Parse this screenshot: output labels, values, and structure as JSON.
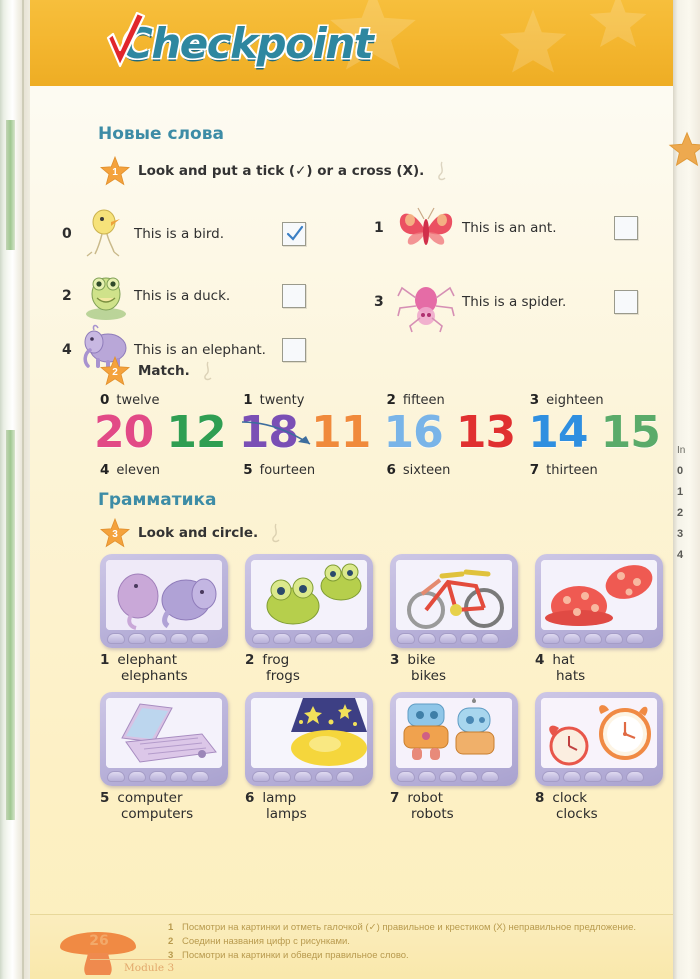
{
  "header": {
    "logo_text": "Checkpoint",
    "logo_check_icon": "red-check-icon"
  },
  "sections": {
    "vocabulary_title": "Новые слова",
    "grammar_title": "Грамматика"
  },
  "exercise1": {
    "number": "1",
    "instruction": "Look and put a tick (✓) or a cross (X).",
    "items": [
      {
        "num": "0",
        "text": "This is a bird.",
        "picture": "duckling-bird-icon",
        "checked": true,
        "mark": "✓"
      },
      {
        "num": "1",
        "text": "This is an ant.",
        "picture": "butterfly-icon",
        "checked": false,
        "mark": ""
      },
      {
        "num": "2",
        "text": "This is a duck.",
        "picture": "frog-icon",
        "checked": false,
        "mark": ""
      },
      {
        "num": "3",
        "text": "This is a spider.",
        "picture": "spider-icon",
        "checked": false,
        "mark": ""
      },
      {
        "num": "4",
        "text": "This is an elephant.",
        "picture": "elephant-icon",
        "checked": false,
        "mark": ""
      }
    ]
  },
  "exercise2": {
    "number": "2",
    "instruction": "Match.",
    "words_top": [
      {
        "num": "0",
        "word": "twelve"
      },
      {
        "num": "1",
        "word": "twenty"
      },
      {
        "num": "2",
        "word": "fifteen"
      },
      {
        "num": "3",
        "word": "eighteen"
      }
    ],
    "numerals": [
      {
        "value": "20",
        "color": "#e24a86"
      },
      {
        "value": "12",
        "color": "#2f9e52"
      },
      {
        "value": "18",
        "color": "#7a4fb5"
      },
      {
        "value": "11",
        "color": "#f08a3c"
      },
      {
        "value": "16",
        "color": "#79b4e8"
      },
      {
        "value": "13",
        "color": "#e03030"
      },
      {
        "value": "14",
        "color": "#2f8fe0"
      },
      {
        "value": "15",
        "color": "#5aab6a"
      }
    ],
    "words_bottom": [
      {
        "num": "4",
        "word": "eleven"
      },
      {
        "num": "5",
        "word": "fourteen"
      },
      {
        "num": "6",
        "word": "sixteen"
      },
      {
        "num": "7",
        "word": "thirteen"
      }
    ]
  },
  "exercise3": {
    "number": "3",
    "instruction": "Look and circle.",
    "items": [
      {
        "num": "1",
        "singular": "elephant",
        "plural": "elephants",
        "picture": "elephants-photo"
      },
      {
        "num": "2",
        "singular": "frog",
        "plural": "frogs",
        "picture": "frogs-photo"
      },
      {
        "num": "3",
        "singular": "bike",
        "plural": "bikes",
        "picture": "bike-photo"
      },
      {
        "num": "4",
        "singular": "hat",
        "plural": "hats",
        "picture": "hats-photo"
      },
      {
        "num": "5",
        "singular": "computer",
        "plural": "computers",
        "picture": "computer-photo"
      },
      {
        "num": "6",
        "singular": "lamp",
        "plural": "lamps",
        "picture": "lamp-photo"
      },
      {
        "num": "7",
        "singular": "robot",
        "plural": "robots",
        "picture": "robots-photo"
      },
      {
        "num": "8",
        "singular": "clock",
        "plural": "clocks",
        "picture": "clocks-photo"
      }
    ]
  },
  "footer": {
    "page_number": "26",
    "module": "Module 3",
    "notes": [
      {
        "num": "1",
        "text": "Посмотри на картинки и отметь галочкой (✓) правильное и крестиком (X) неправильное предложение."
      },
      {
        "num": "2",
        "text": "Соедини названия цифр с рисунками."
      },
      {
        "num": "3",
        "text": "Посмотри на картинки и обведи правильное слово."
      }
    ]
  },
  "next_page": {
    "label": "In",
    "list": [
      "0",
      "1",
      "2",
      "3",
      "4"
    ]
  },
  "colors": {
    "banner": "#f3b52e",
    "logo_teal": "#2e87a0",
    "section_heading": "#3d8ca6",
    "star_badge": "#f4a23c",
    "page_bg_top": "#fdfcf6",
    "page_bg_bottom": "#fcefbe",
    "footer_bg": "#fbedbe"
  }
}
